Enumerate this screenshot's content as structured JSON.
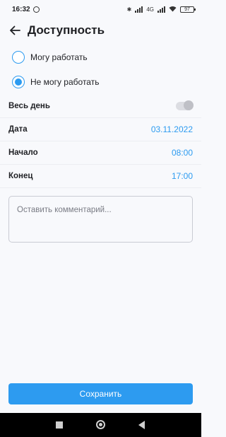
{
  "status_bar": {
    "time": "16:32",
    "network_label": "4G",
    "battery": "97"
  },
  "header": {
    "title": "Доступность",
    "back_icon": "arrow-left-icon"
  },
  "availability": {
    "options": [
      {
        "label": "Могу работать",
        "selected": false
      },
      {
        "label": "Не могу работать",
        "selected": true
      }
    ]
  },
  "form": {
    "all_day": {
      "label": "Весь день",
      "enabled": false
    },
    "date": {
      "label": "Дата",
      "value": "03.11.2022"
    },
    "start": {
      "label": "Начало",
      "value": "08:00"
    },
    "end": {
      "label": "Конец",
      "value": "17:00"
    },
    "comment": {
      "placeholder": "Оставить комментарий...",
      "value": ""
    }
  },
  "actions": {
    "save_label": "Сохранить"
  },
  "colors": {
    "accent": "#2d9bf0",
    "background": "#f8f9fc",
    "nav_bar": "#000000"
  }
}
